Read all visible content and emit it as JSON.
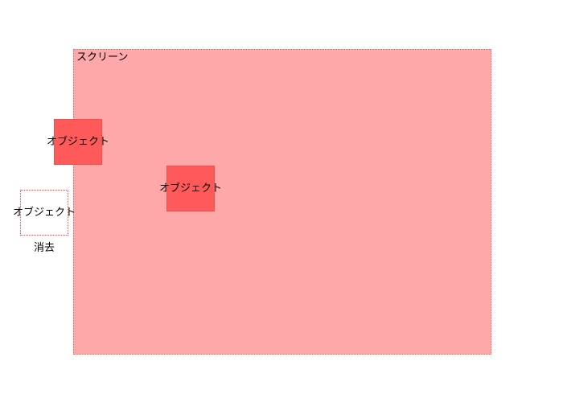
{
  "screen": {
    "label": "スクリーン",
    "fill_color": "#ffa8aa"
  },
  "objects": [
    {
      "label": "オブジェクト",
      "state": "inside",
      "fill_color": "#ff5a5a"
    },
    {
      "label": "オブジェクト",
      "state": "inside",
      "fill_color": "#ff5a5a"
    },
    {
      "label": "オブジェクト",
      "state": "erased",
      "fill_color": "#ffffff"
    }
  ],
  "erase_label": "消去"
}
